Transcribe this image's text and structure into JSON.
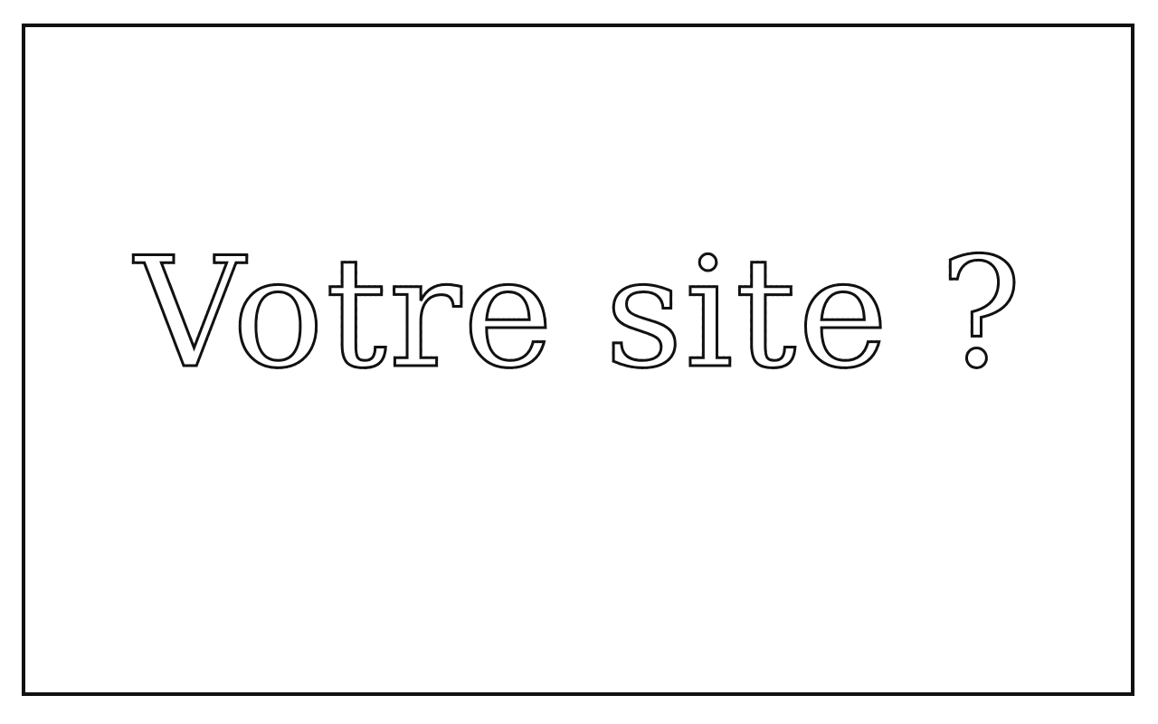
{
  "headline": "Votre site ?"
}
